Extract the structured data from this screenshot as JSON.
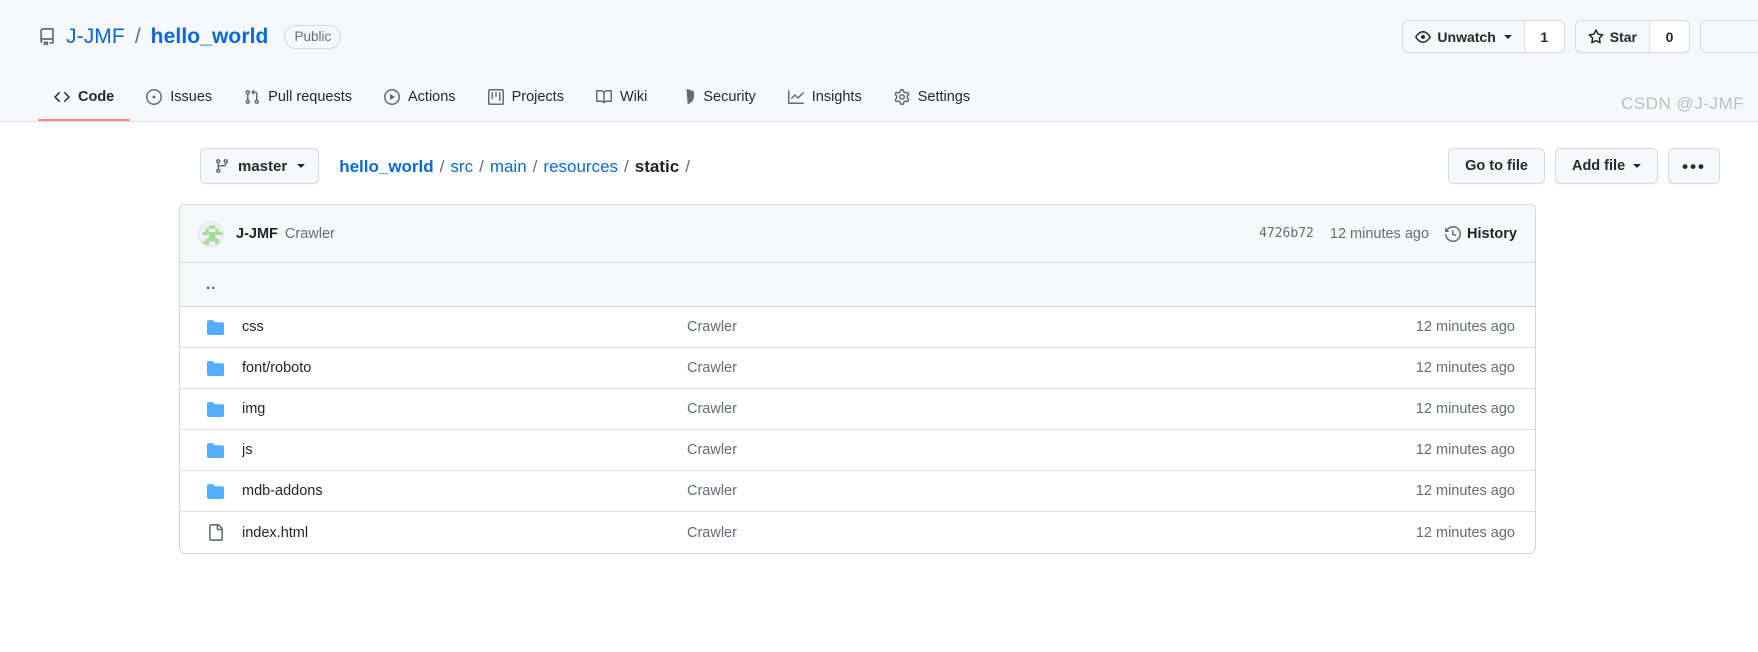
{
  "header": {
    "repo_icon": "repo-icon",
    "owner": "J-JMF",
    "separator": "/",
    "name": "hello_world",
    "visibility": "Public",
    "watch": {
      "icon": "eye-icon",
      "label": "Unwatch",
      "count": "1"
    },
    "star": {
      "icon": "star-icon",
      "label": "Star",
      "count": "0"
    }
  },
  "nav": {
    "items": [
      {
        "icon": "code-icon",
        "label": "Code",
        "selected": true
      },
      {
        "icon": "issue-opened-icon",
        "label": "Issues",
        "selected": false
      },
      {
        "icon": "git-pull-request-icon",
        "label": "Pull requests",
        "selected": false
      },
      {
        "icon": "play-icon",
        "label": "Actions",
        "selected": false
      },
      {
        "icon": "project-icon",
        "label": "Projects",
        "selected": false
      },
      {
        "icon": "book-icon",
        "label": "Wiki",
        "selected": false
      },
      {
        "icon": "shield-icon",
        "label": "Security",
        "selected": false
      },
      {
        "icon": "graph-icon",
        "label": "Insights",
        "selected": false
      },
      {
        "icon": "gear-icon",
        "label": "Settings",
        "selected": false
      }
    ]
  },
  "toolbar": {
    "branch": {
      "icon": "branch-icon",
      "label": "master"
    },
    "breadcrumb": [
      {
        "text": "hello_world",
        "current": false,
        "bold": true
      },
      {
        "text": "src",
        "current": false,
        "bold": false
      },
      {
        "text": "main",
        "current": false,
        "bold": false
      },
      {
        "text": "resources",
        "current": false,
        "bold": false
      },
      {
        "text": "static",
        "current": true,
        "bold": true
      }
    ],
    "breadcrumb_slash": "/",
    "go_to_file": "Go to file",
    "add_file": "Add file",
    "kebab": "•••"
  },
  "commit_bar": {
    "avatar": "user-avatar-identicon",
    "author": "J-JMF",
    "message": "Crawler",
    "sha": "4726b72",
    "time": "12 minutes ago",
    "history_icon": "history-clock-icon",
    "history_label": "History"
  },
  "file_list": {
    "parent_dir": "..",
    "rows": [
      {
        "icon": "folder-icon",
        "type": "folder",
        "name": "css",
        "message": "Crawler",
        "time": "12 minutes ago"
      },
      {
        "icon": "folder-icon",
        "type": "folder",
        "name": "font/roboto",
        "message": "Crawler",
        "time": "12 minutes ago"
      },
      {
        "icon": "folder-icon",
        "type": "folder",
        "name": "img",
        "message": "Crawler",
        "time": "12 minutes ago"
      },
      {
        "icon": "folder-icon",
        "type": "folder",
        "name": "js",
        "message": "Crawler",
        "time": "12 minutes ago"
      },
      {
        "icon": "folder-icon",
        "type": "folder",
        "name": "mdb-addons",
        "message": "Crawler",
        "time": "12 minutes ago"
      },
      {
        "icon": "file-icon",
        "type": "file",
        "name": "index.html",
        "message": "Crawler",
        "time": "12 minutes ago"
      }
    ]
  },
  "watermark": "CSDN @J-JMF",
  "colors": {
    "link": "#0969da",
    "folder": "#54aeff",
    "muted": "#636c76",
    "selected_tab_underline": "#fd8c73",
    "header_bg": "#f6f8fa",
    "border": "#d0d7de"
  }
}
